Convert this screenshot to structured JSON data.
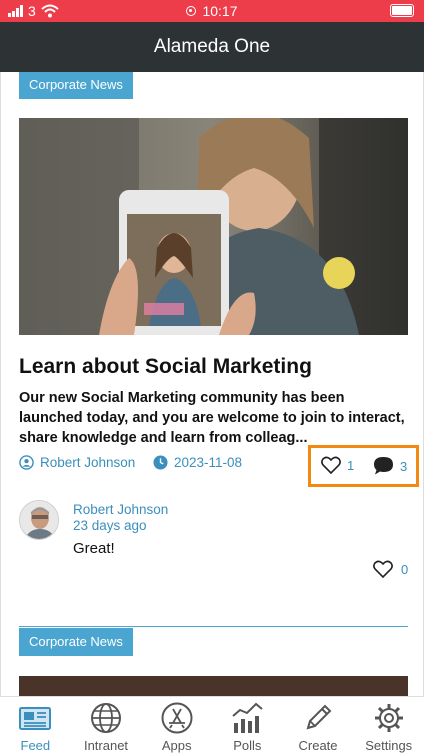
{
  "status_bar": {
    "carrier_signal": "3",
    "time": "10:17"
  },
  "header": {
    "title": "Alameda One"
  },
  "feed": {
    "posts": [
      {
        "category": "Corporate News",
        "title": "Learn about Social Marketing",
        "excerpt": "Our new Social Marketing community has been launched today, and you are welcome to join to interact, share knowledge and learn from colleag...",
        "author": "Robert Johnson",
        "date": "2023-11-08",
        "likes": "1",
        "comments": "3",
        "top_comment": {
          "author": "Robert Johnson",
          "time": "23 days ago",
          "text": "Great!",
          "likes": "0"
        }
      },
      {
        "category": "Corporate News"
      }
    ]
  },
  "tabs": [
    {
      "label": "Feed",
      "icon": "newspaper-icon",
      "active": true
    },
    {
      "label": "Intranet",
      "icon": "globe-icon"
    },
    {
      "label": "Apps",
      "icon": "app-store-icon"
    },
    {
      "label": "Polls",
      "icon": "chart-icon"
    },
    {
      "label": "Create",
      "icon": "pencil-icon"
    },
    {
      "label": "Settings",
      "icon": "gear-icon"
    }
  ],
  "colors": {
    "status_bar": "#ee3d4a",
    "header": "#2d3235",
    "accent": "#4aa6d1",
    "link": "#3a8fbd",
    "highlight": "#f28a12"
  }
}
